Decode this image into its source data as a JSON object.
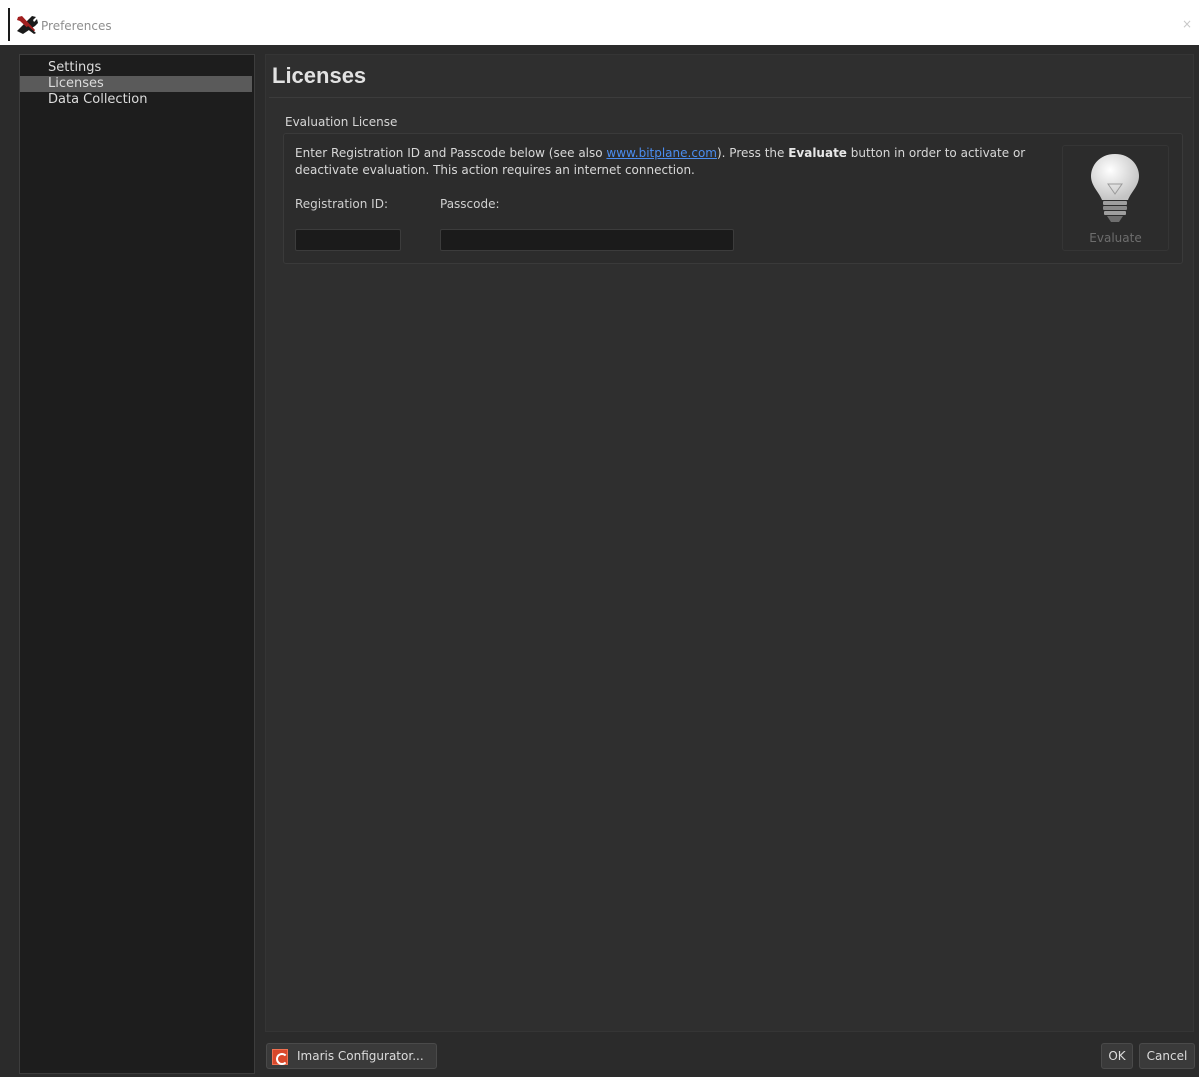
{
  "window": {
    "title": "Preferences",
    "icon": "tools-icon",
    "close_icon": "×"
  },
  "sidebar": {
    "items": [
      {
        "label": "Settings",
        "active": false
      },
      {
        "label": "Licenses",
        "active": true
      },
      {
        "label": "Data Collection",
        "active": false
      }
    ]
  },
  "main": {
    "page_title": "Licenses",
    "section_label": "Evaluation License",
    "description": {
      "text_before_link": "Enter Registration ID and Passcode below (see also ",
      "link_text": "www.bitplane.com",
      "text_after_link": "). Press the ",
      "bold_text": "Evaluate",
      "text_end": " button in order to activate or deactivate evaluation. This action requires an internet connection."
    },
    "registration_id": {
      "label": "Registration ID:",
      "value": ""
    },
    "passcode": {
      "label": "Passcode:",
      "value": ""
    },
    "evaluate_button": {
      "label": "Evaluate",
      "icon": "lightbulb-icon"
    }
  },
  "footer": {
    "configurator_label": "Imaris Configurator...",
    "ok_label": "OK",
    "cancel_label": "Cancel"
  },
  "colors": {
    "background": "#2b2b2b",
    "sidebar_bg": "#1d1d1d",
    "selection": "#5a5a5a",
    "link": "#4a8df0",
    "configurator_icon": "#d9482b"
  }
}
